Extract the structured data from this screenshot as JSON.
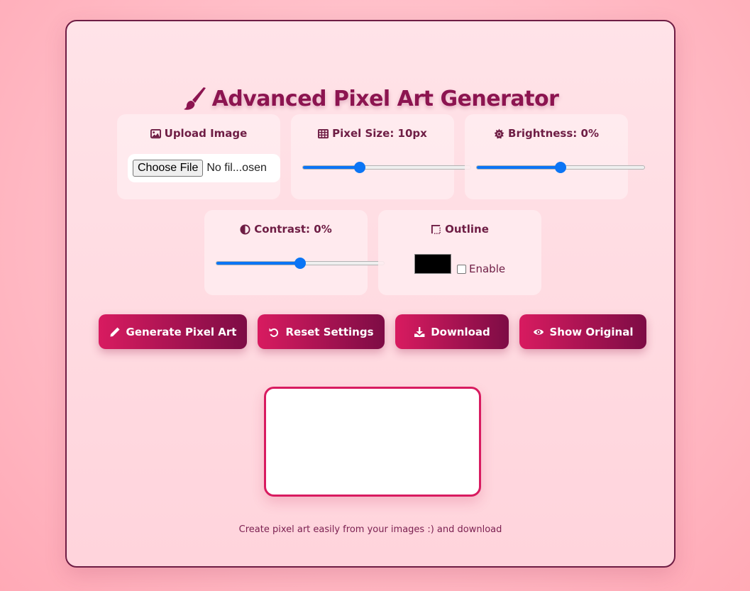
{
  "title": "Advanced Pixel Art Generator",
  "controls": {
    "upload": {
      "label": "Upload Image",
      "button_label": "Choose File",
      "file_status": "No fil...osen"
    },
    "pixel_size": {
      "label": "Pixel Size: 10px",
      "value_fraction": 0.34
    },
    "brightness": {
      "label": "Brightness: 0%",
      "value_fraction": 0.5
    },
    "contrast": {
      "label": "Contrast: 0%",
      "value_fraction": 0.5
    },
    "outline": {
      "label": "Outline",
      "color": "#000000",
      "checkbox_label": "Enable",
      "enabled": false
    }
  },
  "buttons": {
    "generate": "Generate Pixel Art",
    "reset": "Reset Settings",
    "download": "Download",
    "show_original": "Show Original"
  },
  "footer": "Create pixel art easily from your images :) and download",
  "colors": {
    "accent": "#d81b60",
    "accent_dark": "#7d0c45",
    "title": "#8c1450",
    "text": "#6e1d44",
    "slider": "#0b75f5"
  }
}
